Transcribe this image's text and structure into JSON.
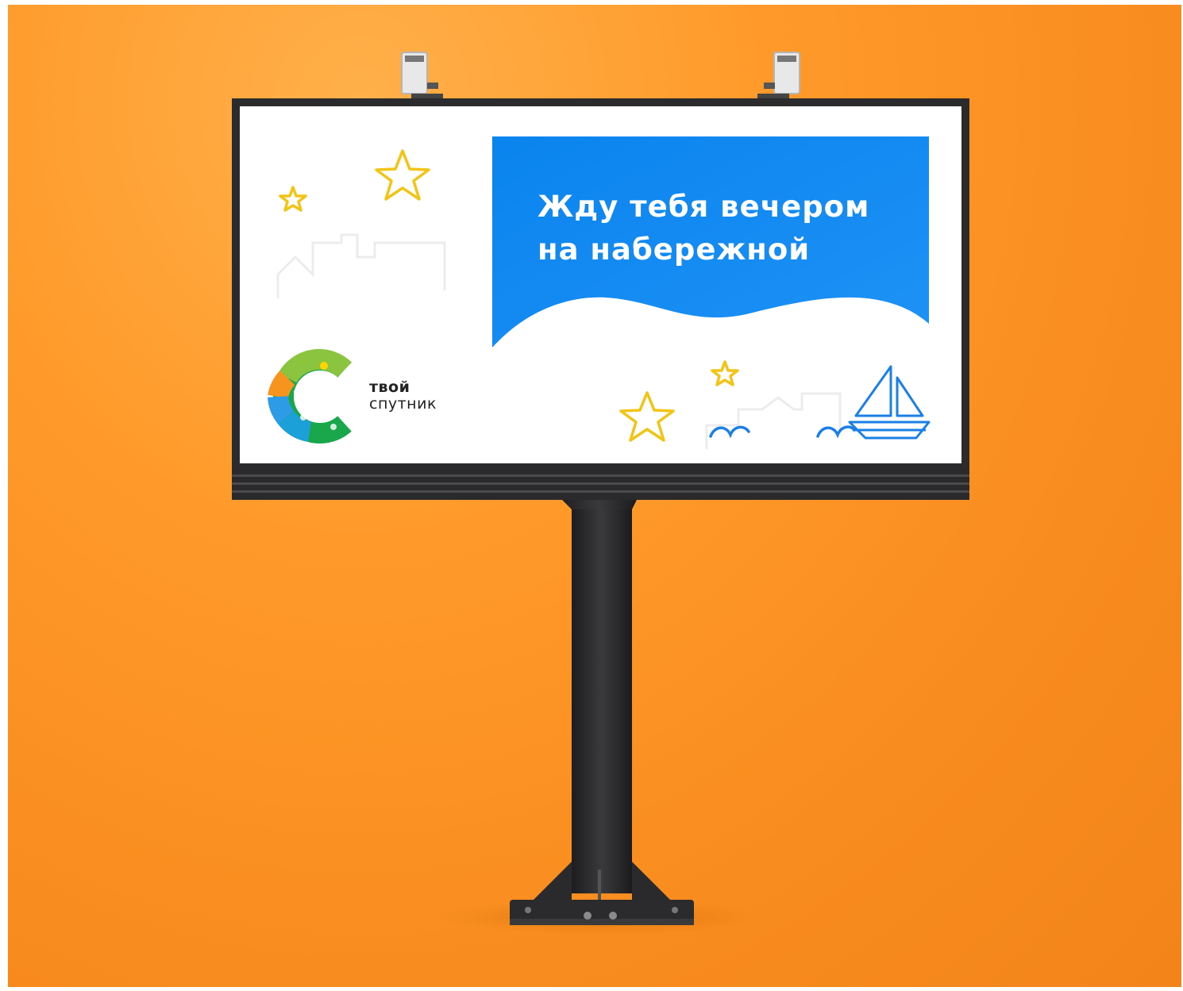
{
  "billboard": {
    "headline_line1": "Жду тебя вечером",
    "headline_line2": "на набережной",
    "brand_line1": "твой",
    "brand_line2": "спутник"
  },
  "colors": {
    "background": "#f98c1e",
    "panel_blue": "#0d87f0",
    "star_yellow": "#f2c416",
    "frame": "#2b2b2b",
    "line_blue": "#1a7fe6"
  },
  "icons": [
    "star-icon",
    "sailboat-icon",
    "seagull-icon",
    "city-outline",
    "spotlight",
    "logo-c-mark"
  ]
}
